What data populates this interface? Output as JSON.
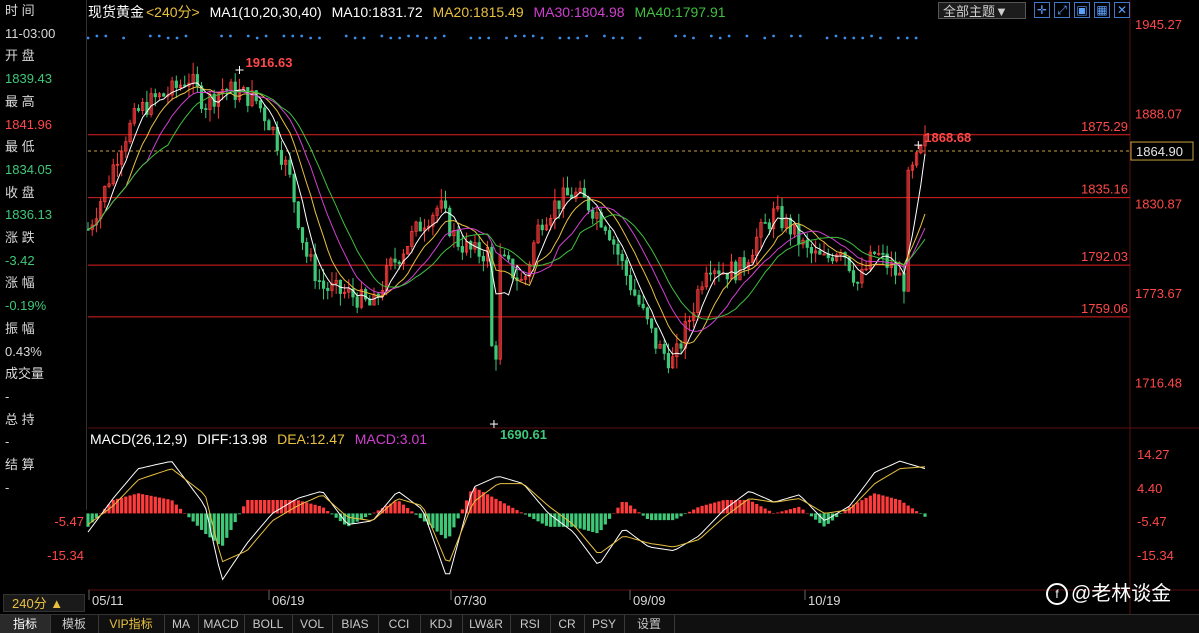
{
  "info_panel": {
    "rows": [
      {
        "label": "时 间",
        "value": "11-03:00",
        "color": "#d8d8d8"
      },
      {
        "label": "开 盘",
        "value": "1839.43",
        "color": "#3ec878"
      },
      {
        "label": "最 高",
        "value": "1841.96",
        "color": "#ff4848"
      },
      {
        "label": "最 低",
        "value": "1834.05",
        "color": "#3ec878"
      },
      {
        "label": "收 盘",
        "value": "1836.13",
        "color": "#3ec878"
      },
      {
        "label": "涨 跌",
        "value": "-3.42",
        "color": "#3ec878"
      },
      {
        "label": "涨 幅",
        "value": "-0.19%",
        "color": "#3ec878"
      },
      {
        "label": "振 幅",
        "value": "0.43%",
        "color": "#d8d8d8"
      },
      {
        "label": "成交量",
        "value": "-",
        "color": "#d8d8d8"
      },
      {
        "label": "总 持",
        "value": "-",
        "color": "#d8d8d8"
      },
      {
        "label": "结 算",
        "value": "-",
        "color": "#d8d8d8"
      }
    ]
  },
  "legend": {
    "symbol": "现货黄金",
    "period": "<240分>",
    "ma_label": "MA1(10,20,30,40)",
    "ma10": "MA10:1831.72",
    "ma20": "MA20:1815.49",
    "ma30": "MA30:1804.98",
    "ma40": "MA40:1797.91"
  },
  "toolbar": {
    "theme_label": "全部主题▼"
  },
  "colors": {
    "up": "#ff3b3b",
    "down": "#3ec878",
    "ma10": "#ffffff",
    "ma20": "#e8c040",
    "ma30": "#d040d0",
    "ma40": "#40c040",
    "axis": "#ff4848",
    "hline": "#e02020",
    "dots": "#3a8ee8"
  },
  "macd_legend": {
    "label": "MACD(26,12,9)",
    "diff": "DIFF:13.98",
    "dea": "DEA:12.47",
    "macd": "MACD:3.01"
  },
  "period_button": "240分 ▲",
  "tabs": [
    "指标",
    "模板",
    "VIP指标",
    "MA",
    "MACD",
    "BOLL",
    "VOL",
    "BIAS",
    "CCI",
    "KDJ",
    "LW&R",
    "RSI",
    "CR",
    "PSY",
    "设置"
  ],
  "watermark": "@老林谈金",
  "chart_data": {
    "type": "candlestick",
    "price_axis": {
      "ylim": [
        1690,
        1946
      ],
      "ticks": [
        1945.27,
        1888.07,
        1830.87,
        1773.67,
        1716.48
      ],
      "current_price": "1864.90"
    },
    "horizontal_lines": [
      {
        "value": 1875.29,
        "label": "1875.29"
      },
      {
        "value": 1835.16,
        "label": "1835.16"
      },
      {
        "value": 1792.03,
        "label": "1792.03"
      },
      {
        "value": 1759.06,
        "label": "1759.06"
      }
    ],
    "dashed_line": 1864.9,
    "annotations": [
      {
        "text": "1916.63",
        "value": 1916.63,
        "t": 0.181,
        "color": "#ff4848"
      },
      {
        "text": "1690.61",
        "value": 1690.61,
        "t": 0.485,
        "color": "#3ec878"
      },
      {
        "text": "1868.68",
        "value": 1868.68,
        "t": 0.992,
        "color": "#ff4848"
      }
    ],
    "x_labels": [
      "05/11",
      "06/19",
      "07/30",
      "09/09",
      "10/19"
    ],
    "macd_axis": {
      "ylim": [
        -20,
        17
      ],
      "ticks": [
        "14.27",
        "4.40",
        "-5.47",
        "-15.34"
      ],
      "left_labels": [
        "-5.47",
        "-15.34"
      ]
    },
    "price_path": [
      [
        0,
        1815
      ],
      [
        0.02,
        1840
      ],
      [
        0.04,
        1870
      ],
      [
        0.06,
        1890
      ],
      [
        0.08,
        1898
      ],
      [
        0.1,
        1903
      ],
      [
        0.12,
        1912
      ],
      [
        0.14,
        1895
      ],
      [
        0.16,
        1905
      ],
      [
        0.18,
        1902
      ],
      [
        0.2,
        1898
      ],
      [
        0.22,
        1880
      ],
      [
        0.24,
        1850
      ],
      [
        0.26,
        1800
      ],
      [
        0.28,
        1778
      ],
      [
        0.3,
        1775
      ],
      [
        0.32,
        1772
      ],
      [
        0.34,
        1765
      ],
      [
        0.36,
        1790
      ],
      [
        0.38,
        1805
      ],
      [
        0.4,
        1820
      ],
      [
        0.42,
        1830
      ],
      [
        0.44,
        1808
      ],
      [
        0.46,
        1800
      ],
      [
        0.48,
        1800
      ],
      [
        0.5,
        1792
      ],
      [
        0.52,
        1780
      ],
      [
        0.54,
        1820
      ],
      [
        0.56,
        1832
      ],
      [
        0.58,
        1838
      ],
      [
        0.6,
        1830
      ],
      [
        0.62,
        1818
      ],
      [
        0.64,
        1790
      ],
      [
        0.66,
        1765
      ],
      [
        0.68,
        1740
      ],
      [
        0.7,
        1730
      ],
      [
        0.72,
        1760
      ],
      [
        0.74,
        1795
      ],
      [
        0.76,
        1788
      ],
      [
        0.78,
        1790
      ],
      [
        0.8,
        1810
      ],
      [
        0.82,
        1825
      ],
      [
        0.84,
        1815
      ],
      [
        0.86,
        1800
      ],
      [
        0.88,
        1795
      ],
      [
        0.9,
        1805
      ],
      [
        0.92,
        1780
      ],
      [
        0.94,
        1800
      ],
      [
        0.96,
        1790
      ],
      [
        0.98,
        1778
      ],
      [
        1.0,
        1780
      ]
    ],
    "price_path_note_removed": true,
    "diff_path": [
      [
        0,
        -5
      ],
      [
        0.03,
        4
      ],
      [
        0.06,
        12
      ],
      [
        0.1,
        14
      ],
      [
        0.14,
        2
      ],
      [
        0.16,
        -18
      ],
      [
        0.19,
        -8
      ],
      [
        0.22,
        0
      ],
      [
        0.25,
        4
      ],
      [
        0.28,
        6
      ],
      [
        0.31,
        -3
      ],
      [
        0.34,
        -2
      ],
      [
        0.37,
        6
      ],
      [
        0.4,
        1
      ],
      [
        0.43,
        -18
      ],
      [
        0.46,
        7
      ],
      [
        0.49,
        10
      ],
      [
        0.52,
        8
      ],
      [
        0.55,
        0
      ],
      [
        0.58,
        -5
      ],
      [
        0.61,
        -14
      ],
      [
        0.64,
        -4
      ],
      [
        0.67,
        -9
      ],
      [
        0.7,
        -10
      ],
      [
        0.73,
        -6
      ],
      [
        0.76,
        1
      ],
      [
        0.79,
        6
      ],
      [
        0.82,
        3
      ],
      [
        0.85,
        5
      ],
      [
        0.88,
        -2
      ],
      [
        0.91,
        2
      ],
      [
        0.94,
        11
      ],
      [
        0.97,
        14
      ],
      [
        1,
        12
      ]
    ],
    "dea_path": [
      [
        0,
        -3
      ],
      [
        0.03,
        2
      ],
      [
        0.06,
        9
      ],
      [
        0.1,
        12
      ],
      [
        0.14,
        5
      ],
      [
        0.16,
        -13
      ],
      [
        0.19,
        -10
      ],
      [
        0.22,
        -2
      ],
      [
        0.25,
        2
      ],
      [
        0.28,
        5
      ],
      [
        0.31,
        -1
      ],
      [
        0.34,
        -2
      ],
      [
        0.37,
        4
      ],
      [
        0.4,
        2
      ],
      [
        0.43,
        -14
      ],
      [
        0.46,
        3
      ],
      [
        0.49,
        8
      ],
      [
        0.52,
        8
      ],
      [
        0.55,
        2
      ],
      [
        0.58,
        -3
      ],
      [
        0.61,
        -11
      ],
      [
        0.64,
        -6
      ],
      [
        0.67,
        -8
      ],
      [
        0.7,
        -9
      ],
      [
        0.73,
        -7
      ],
      [
        0.76,
        -1
      ],
      [
        0.79,
        4
      ],
      [
        0.82,
        3
      ],
      [
        0.85,
        4
      ],
      [
        0.88,
        0
      ],
      [
        0.91,
        1
      ],
      [
        0.94,
        8
      ],
      [
        0.97,
        12
      ],
      [
        1,
        12.5
      ]
    ]
  }
}
